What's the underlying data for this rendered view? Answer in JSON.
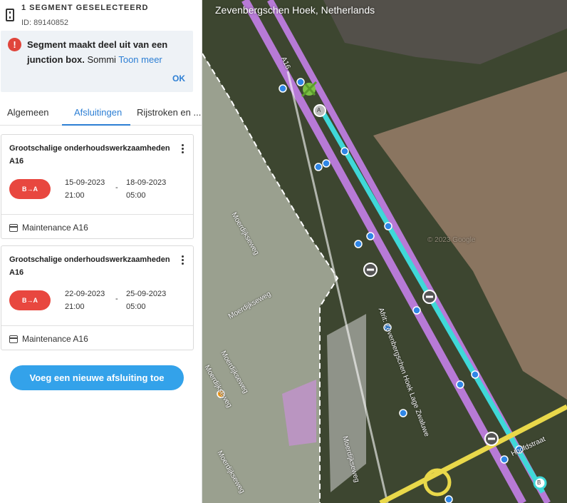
{
  "segment": {
    "title": "1 SEGMENT GESELECTEERD",
    "id_label": "ID: 89140852"
  },
  "alert": {
    "icon": "!",
    "bold_text": "Segment maakt deel uit van een junction box.",
    "rest_text": " Sommi",
    "more_link": "Toon meer",
    "ok_label": "OK"
  },
  "tabs": [
    {
      "label": "Algemeen"
    },
    {
      "label": "Afsluitingen"
    },
    {
      "label": "Rijstroken en ..."
    }
  ],
  "closures": [
    {
      "title": "Grootschalige onderhoudswerkzaamheden A16",
      "direction": "B→A",
      "start_date": "15-09-2023",
      "start_time": "21:00",
      "end_date": "18-09-2023",
      "end_time": "05:00",
      "separator": "-",
      "event": "Maintenance A16"
    },
    {
      "title": "Grootschalige onderhoudswerkzaamheden A16",
      "direction": "B→A",
      "start_date": "22-09-2023",
      "start_time": "21:00",
      "end_date": "25-09-2023",
      "end_time": "05:00",
      "separator": "-",
      "event": "Maintenance A16"
    }
  ],
  "add_button_label": "Voeg een nieuwe afsluiting toe",
  "map": {
    "location": "Zevenbergschen Hoek, Netherlands",
    "street_labels": [
      "Moerdijkseweg",
      "Moerdijkseweg",
      "Moerdijkseweg",
      "Moerdijkseweg",
      "Moerdijkseweg",
      "Moerdijkseweg",
      "Afrit: Zevenbergschen Hoek Lage Zwaluwe",
      "Hoofdstraat",
      "A16"
    ],
    "node_a": "A",
    "node_b": "B",
    "watermark": "© 2023 Google",
    "colors": {
      "selected_segment": "#3fd8d8",
      "road_purple": "#b77ad6",
      "road_yellow": "#e9d84a",
      "node_blue": "#2f86e6"
    }
  }
}
